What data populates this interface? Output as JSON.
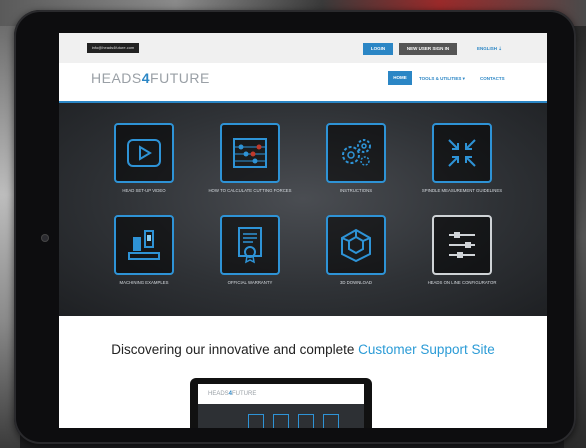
{
  "topbar": {
    "email": "info@heads4future.com",
    "login_label": "LOGIN",
    "signup_label": "NEW USER SIGN IN",
    "language": "ENGLISH ⇣"
  },
  "header": {
    "logo_text_a": "HEADS",
    "logo_text_four": "4",
    "logo_text_b": "FUTURE",
    "nav": {
      "home": "HOME",
      "tools": "TOOLS & UTILITIES ▾",
      "contacts": "CONTACTS"
    }
  },
  "tiles": [
    {
      "label": "HEAD SET-UP VIDEO",
      "icon": "play-video-icon"
    },
    {
      "label": "HOW TO CALCULATE CUTTING FORCES",
      "icon": "abacus-icon"
    },
    {
      "label": "INSTRUCTIONS",
      "icon": "gears-icon"
    },
    {
      "label": "SPINDLE MEASUREMENT GUIDELINES",
      "icon": "arrows-inward-icon"
    },
    {
      "label": "MACHINING EXAMPLES",
      "icon": "machine-icon"
    },
    {
      "label": "OFFICIAL WARRANTY",
      "icon": "certificate-icon"
    },
    {
      "label": "3D DOWNLOAD",
      "icon": "cube-icon"
    },
    {
      "label": "HEADS ON LINE CONFIGURATOR",
      "icon": "sliders-icon"
    }
  ],
  "headline": {
    "prefix": "Discovering our innovative and complete ",
    "accent": "Customer Support Site"
  },
  "laptop": {
    "logo_text_a": "HEADS",
    "logo_text_four": "4",
    "logo_text_b": "FUTURE"
  },
  "colors": {
    "accent": "#2b86c5",
    "tile_border": "#2e93d6",
    "bezel": "#0d0d0f"
  }
}
